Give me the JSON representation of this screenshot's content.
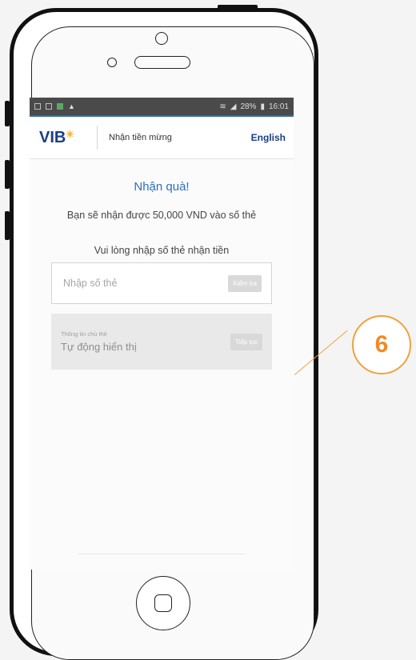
{
  "status_bar": {
    "battery": "28%",
    "time": "16:01"
  },
  "app_bar": {
    "logo": "VIB",
    "title": "Nhận tiền mừng",
    "language_link": "English"
  },
  "main": {
    "heading": "Nhận quà!",
    "receive_message": "Bạn sẽ nhận được 50,000 VND vào số thẻ",
    "card_prompt": "Vui lòng nhập số thẻ nhận tiền",
    "card_input_placeholder": "Nhập số thẻ",
    "check_button": "Kiểm tra",
    "holder_info_label": "Thông tin chủ thẻ",
    "holder_info_value": "Tự động hiển thị",
    "continue_button": "Tiếp tục"
  },
  "callout": {
    "number": "6"
  },
  "colors": {
    "brand_blue": "#1a3f84",
    "link_blue": "#2b6fc0",
    "callout_orange": "#f2a13c",
    "logo_star": "#f4b223"
  }
}
